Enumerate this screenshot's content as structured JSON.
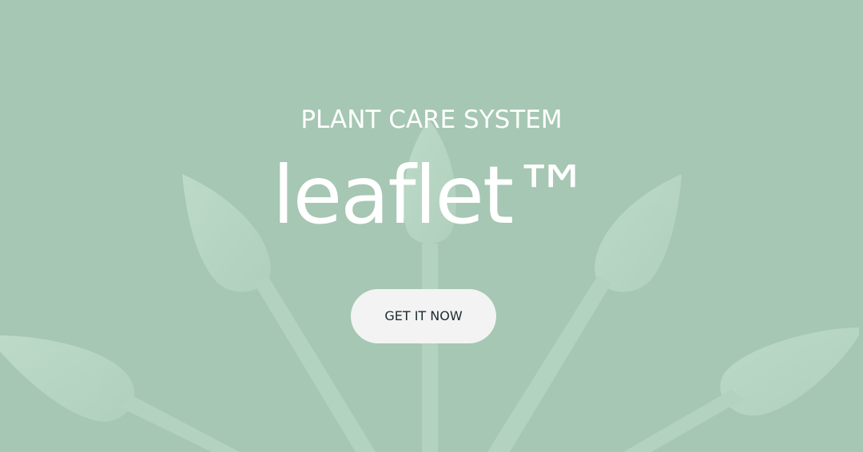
{
  "hero": {
    "subtitle": "PLANT CARE SYSTEM",
    "brand": "leaflet™",
    "cta_label": "GET IT NOW",
    "background_color": "#a5c7b3",
    "image_subject": "light green plant-shaped sensor stakes fanned out"
  }
}
